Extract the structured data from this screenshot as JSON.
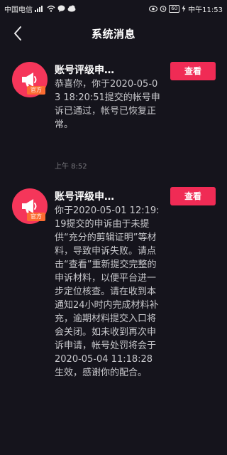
{
  "status_bar": {
    "carrier": "中国电信",
    "network": "4G",
    "battery": "60",
    "time": "中午11:53"
  },
  "header": {
    "title": "系统消息",
    "back_icon": "chevron-left-icon"
  },
  "messages": [
    {
      "title": "账号评级申…",
      "badge": "官方",
      "body": "恭喜你，你于2020-05-03 18:20:51提交的帐号申诉已通过，帐号已恢复正常。",
      "time": "上午 8:52",
      "button_label": "查看"
    },
    {
      "title": "账号评级申…",
      "badge": "官方",
      "body": "你于2020-05-01 12:19:19提交的申诉由于未提供“充分的剪辑证明”等材料，导致申诉失败。请点击“查看”重新提交完整的申诉材料，以便平台进一步定位核查。请在收到本通知24小时内完成材料补充，逾期材料提交入口将会关闭。如未收到再次申诉申请，帐号处罚将会于2020-05-04 11:18:28生效，感谢你的配合。",
      "button_label": "查看"
    }
  ],
  "colors": {
    "background": "#15141c",
    "accent": "#f02b55",
    "badge": "#fc6c31"
  }
}
